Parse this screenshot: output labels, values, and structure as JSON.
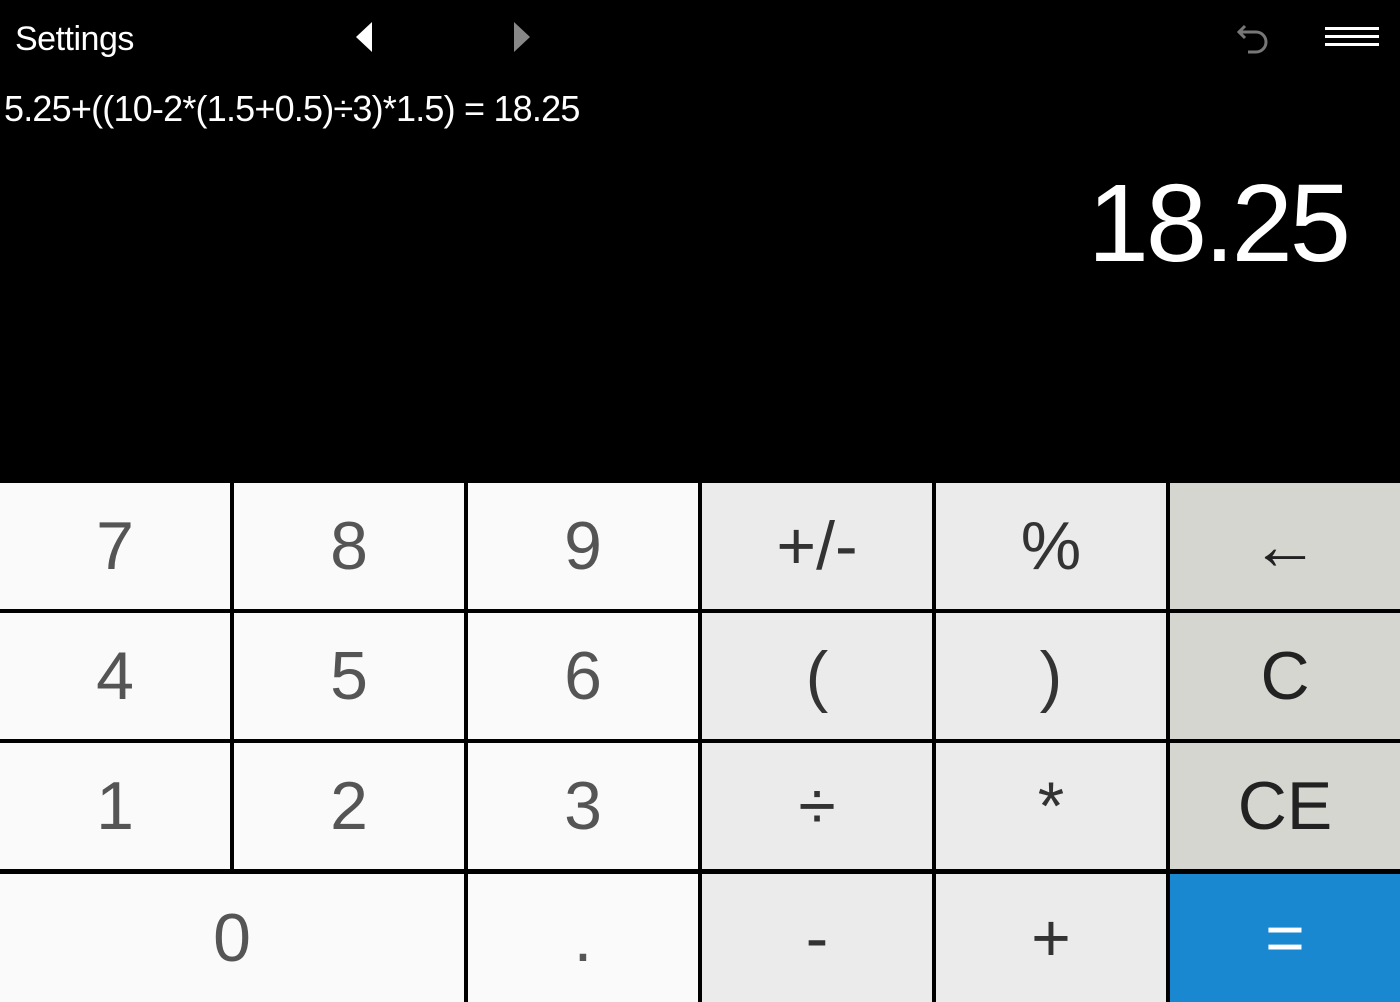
{
  "topbar": {
    "settings_label": "Settings",
    "prev_icon": "triangle-left-icon",
    "next_icon": "triangle-right-icon",
    "undo_icon": "undo-arrow-icon",
    "menu_icon": "hamburger-menu-icon"
  },
  "display": {
    "history": "5.25+((10-2*(1.5+0.5)÷3)*1.5) = 18.25",
    "result": "18.25"
  },
  "keypad": {
    "k7": "7",
    "k8": "8",
    "k9": "9",
    "plusminus": "+/-",
    "percent": "%",
    "backspace": "←",
    "k4": "4",
    "k5": "5",
    "k6": "6",
    "lparen": "(",
    "rparen": ")",
    "clear": "C",
    "k1": "1",
    "k2": "2",
    "k3": "3",
    "divide": "÷",
    "multiply": "*",
    "clear_entry": "CE",
    "k0": "0",
    "decimal": ".",
    "minus": "-",
    "plus": "+",
    "equals": "="
  },
  "colors": {
    "equals_bg": "#1a88d0",
    "number_bg": "#fafafa",
    "operator_bg": "#ebebeb",
    "function_bg": "#d6d6d1",
    "display_bg": "#000000"
  }
}
